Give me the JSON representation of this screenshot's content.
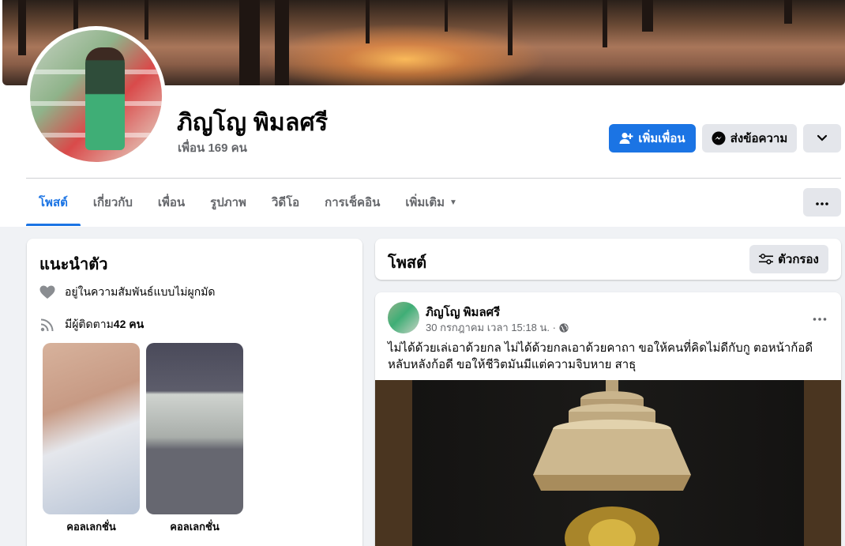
{
  "profile": {
    "name": "ภิญโญ พิมลศรี",
    "friends_count": "เพื่อน 169 คน"
  },
  "actions": {
    "add_friend": "เพิ่มเพื่อน",
    "message": "ส่งข้อความ"
  },
  "tabs": [
    {
      "label": "โพสต์",
      "active": true
    },
    {
      "label": "เกี่ยวกับ"
    },
    {
      "label": "เพื่อน"
    },
    {
      "label": "รูปภาพ"
    },
    {
      "label": "วิดีโอ"
    },
    {
      "label": "การเช็คอิน"
    },
    {
      "label": "เพิ่มเติม"
    }
  ],
  "intro": {
    "title": "แนะนำตัว",
    "relationship": "อยู่ในความสัมพันธ์แบบไม่ผูกมัด",
    "followers_prefix": "มีผู้ติดตาม ",
    "followers_count": "42 คน",
    "collections": [
      {
        "label": "คอลเลกชั่น"
      },
      {
        "label": "คอลเลกชั่น"
      }
    ]
  },
  "posts_section": {
    "title": "โพสต์",
    "filter_label": "ตัวกรอง"
  },
  "post": {
    "author": "ภิญโญ พิมลศรี",
    "timestamp": "30 กรกฎาคม เวลา 15:18 น. ·",
    "text": "ไม่ได้ด้วยเล่เอาด้วยกล ไม่ได้ด้วยกลเอาด้วยคาถา  ขอให้คนที่คิดไม่ดีกับกู ตอหน้าก้อดี หลับหลังก้อดี ขอให้ชีวิตมันมีแต่ความจิบหาย  สาธุ"
  },
  "colors": {
    "accent": "#1b74e4",
    "page_bg": "#f0f2f5",
    "secondary_text": "#65676b",
    "button_gray": "#e4e6eb"
  },
  "icons": {
    "add_friend": "person-plus-icon",
    "message": "messenger-icon",
    "more": "chevron-down-icon",
    "tab_menu": "ellipsis-icon",
    "relationship": "heart-icon",
    "followers": "rss-icon",
    "filter": "sliders-icon",
    "privacy": "globe-icon",
    "post_menu": "ellipsis-icon"
  }
}
